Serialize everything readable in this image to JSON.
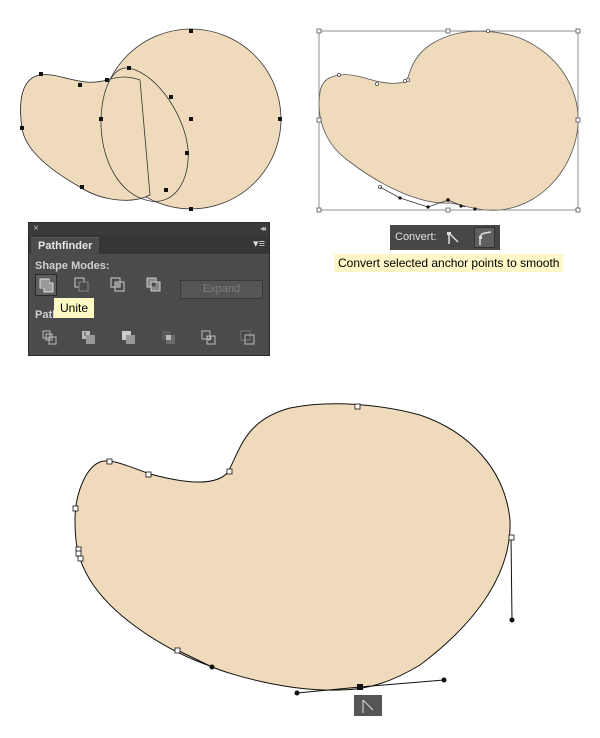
{
  "colors": {
    "shape_fill": "#efdbbb",
    "panel_bg": "#4b4b4b",
    "tooltip_bg": "#fff9c4"
  },
  "pathfinder_panel": {
    "close_icon": "×",
    "collapse_icon": "◂◂",
    "tab_label": "Pathfinder",
    "menu_icon": "▾≡",
    "shape_modes_label": "Shape Modes:",
    "shape_mode_buttons": [
      {
        "name": "unite",
        "icon": "unite-icon",
        "active": true
      },
      {
        "name": "minus-front",
        "icon": "minus-front-icon",
        "active": false
      },
      {
        "name": "intersect",
        "icon": "intersect-icon",
        "active": false
      },
      {
        "name": "exclude",
        "icon": "exclude-icon",
        "active": false
      }
    ],
    "expand_label": "Expand",
    "pathfinders_label": "Path",
    "pathfinder_buttons": [
      {
        "name": "divide",
        "icon": "divide-icon"
      },
      {
        "name": "trim",
        "icon": "trim-icon"
      },
      {
        "name": "merge",
        "icon": "merge-icon"
      },
      {
        "name": "crop",
        "icon": "crop-icon"
      },
      {
        "name": "outline",
        "icon": "outline-icon"
      },
      {
        "name": "minus-back",
        "icon": "minus-back-icon"
      }
    ],
    "tooltip": "Unite"
  },
  "convert_control": {
    "label": "Convert:",
    "buttons": [
      {
        "name": "convert-to-corner",
        "icon": "corner-point-icon",
        "active": false
      },
      {
        "name": "convert-to-smooth",
        "icon": "smooth-point-icon",
        "active": true
      }
    ],
    "tooltip": "Convert selected anchor points to smooth"
  },
  "canvas": {
    "steps": [
      {
        "name": "overlapping-shapes",
        "description": "blob and circle with ellipse before unite"
      },
      {
        "name": "united-shape-selected",
        "description": "united shape with bounding box"
      },
      {
        "name": "edited-united-shape",
        "description": "united shape with anchor handles"
      }
    ],
    "anchor_widget_icon": "corner-anchor-icon"
  }
}
